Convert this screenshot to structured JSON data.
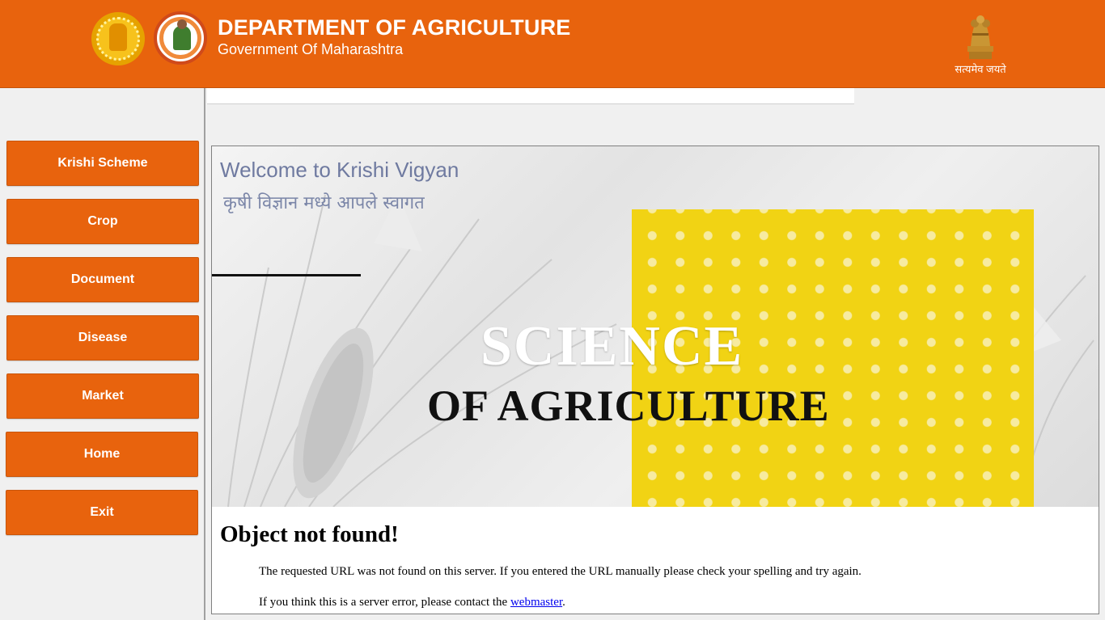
{
  "header": {
    "title": "DEPARTMENT OF AGRICULTURE",
    "subtitle": "Government Of Maharashtra",
    "motto": "सत्यमेव जयते",
    "seal_icon": "maharashtra-seal-icon",
    "logo_icon": "krishi-logo-icon",
    "emblem_icon": "national-emblem-icon"
  },
  "sidebar": {
    "items": [
      {
        "label": "Krishi Scheme"
      },
      {
        "label": "Crop"
      },
      {
        "label": "Document"
      },
      {
        "label": "Disease"
      },
      {
        "label": "Market"
      },
      {
        "label": "Home"
      },
      {
        "label": "Exit"
      }
    ]
  },
  "banner": {
    "welcome_en": "Welcome to Krishi Vigyan",
    "welcome_hi": "कृषी विज्ञान मध्ये आपले स्वागत",
    "headline_1": "SCIENCE",
    "headline_2": "OF AGRICULTURE"
  },
  "error_page": {
    "heading": "Object not found!",
    "message": "The requested URL was not found on this server. If you entered the URL manually please check your spelling and try again.",
    "contact_prefix": "If you think this is a server error, please contact the ",
    "contact_link": "webmaster",
    "contact_suffix": "."
  },
  "colors": {
    "brand_orange": "#e8630d",
    "banner_yellow": "#f1d314",
    "link_blue": "#0000ee"
  }
}
